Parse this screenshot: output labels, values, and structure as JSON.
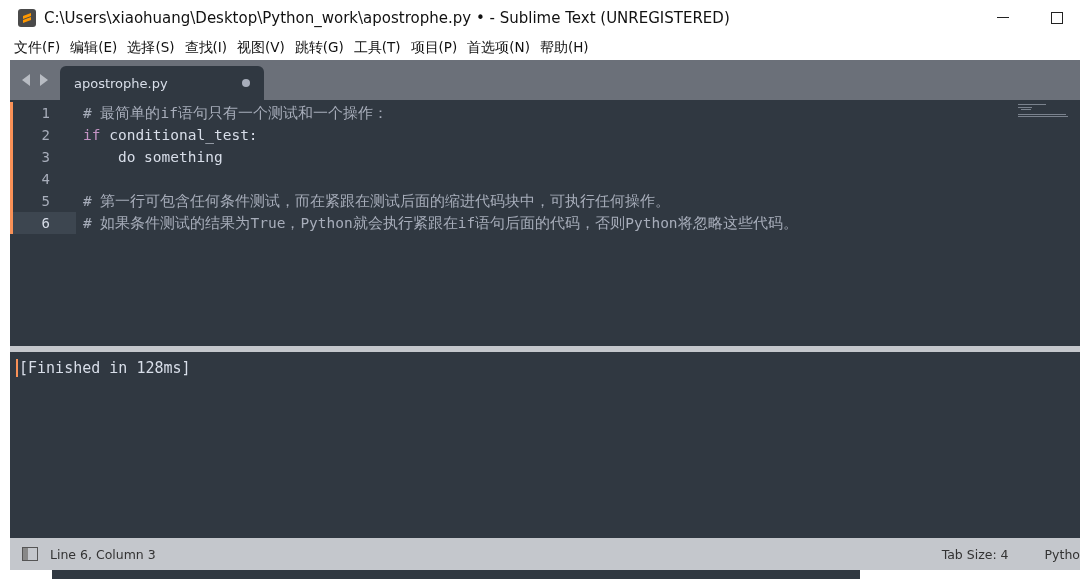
{
  "window": {
    "title": "C:\\Users\\xiaohuang\\Desktop\\Python_work\\apostrophe.py • - Sublime Text (UNREGISTERED)"
  },
  "menu": [
    "文件(F)",
    "编辑(E)",
    "选择(S)",
    "查找(I)",
    "视图(V)",
    "跳转(G)",
    "工具(T)",
    "项目(P)",
    "首选项(N)",
    "帮助(H)"
  ],
  "tabs": [
    {
      "label": "apostrophe.py",
      "selected": true,
      "modified": true
    }
  ],
  "editor": {
    "lines": [
      {
        "number": "1",
        "modified": true,
        "selected": false,
        "tokens": [
          {
            "kind": "comment",
            "text": "# 最简单的if语句只有一个测试和一个操作："
          }
        ]
      },
      {
        "number": "2",
        "modified": true,
        "selected": false,
        "tokens": [
          {
            "kind": "keyword",
            "text": "if"
          },
          {
            "kind": "plain",
            "text": " conditional_test:"
          }
        ]
      },
      {
        "number": "3",
        "modified": true,
        "selected": false,
        "tokens": [
          {
            "kind": "plain",
            "text": "    do something"
          }
        ]
      },
      {
        "number": "4",
        "modified": true,
        "selected": false
      },
      {
        "number": "5",
        "modified": true,
        "selected": false,
        "tokens": [
          {
            "kind": "comment",
            "text": "# 第一行可包含任何条件测试，而在紧跟在测试后面的缩进代码块中，可执行任何操作。"
          }
        ]
      },
      {
        "number": "6",
        "modified": true,
        "selected": true,
        "tokens": [
          {
            "kind": "comment",
            "text": "# 如果条件测试的结果为True，Python就会执行紧跟在if语句后面的代码，否则Python将忽略这些代码。"
          }
        ]
      }
    ]
  },
  "output": {
    "text": "[Finished in 128ms]"
  },
  "status_bar": {
    "position": "Line 6, Column 3",
    "tab_size": "Tab Size: 4",
    "syntax": "Pytho"
  }
}
